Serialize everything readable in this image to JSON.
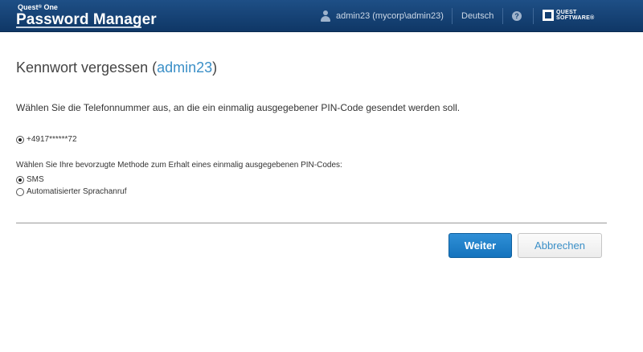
{
  "header": {
    "brand_top": "Quest",
    "brand_sup": "®",
    "brand_top_suffix": " One",
    "brand_main": "Password Manager",
    "user": "admin23 (mycorp\\admin23)",
    "language": "Deutsch",
    "help": "?",
    "vendor_line1": "QUEST",
    "vendor_line2": "SOFTWARE",
    "vendor_tm": "®"
  },
  "page": {
    "title_prefix": "Kennwort vergessen (",
    "title_user": "admin23",
    "title_suffix": ")",
    "instruction": "Wählen Sie die Telefonnummer aus, an die ein einmalig ausgegebener PIN-Code gesendet werden soll."
  },
  "phone": {
    "number": "+4917******72",
    "selected": true
  },
  "method": {
    "label": "Wählen Sie Ihre bevorzugte Methode zum Erhalt eines einmalig ausgegebenen PIN-Codes:",
    "options": [
      {
        "label": "SMS",
        "selected": true
      },
      {
        "label": "Automatisierter Sprachanruf",
        "selected": false
      }
    ]
  },
  "buttons": {
    "next": "Weiter",
    "cancel": "Abbrechen"
  },
  "colors": {
    "header_bg": "#123f72",
    "accent": "#3a8fc7",
    "primary_button": "#1a7cc6"
  }
}
